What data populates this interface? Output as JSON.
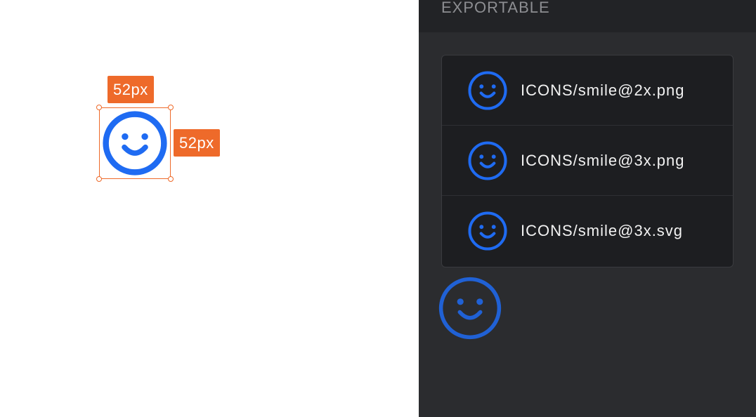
{
  "canvas": {
    "width_badge": "52px",
    "height_badge": "52px",
    "icon": "smile-icon",
    "selection_color": "#ee6a2a",
    "icon_color": "#1f6bf2"
  },
  "panel": {
    "title": "EXPORTABLE",
    "items": [
      {
        "label": "ICONS/smile@2x.png",
        "icon": "smile-icon"
      },
      {
        "label": "ICONS/smile@3x.png",
        "icon": "smile-icon"
      },
      {
        "label": "ICONS/smile@3x.svg",
        "icon": "smile-icon"
      }
    ],
    "drag_preview_icon": "smile-icon"
  }
}
